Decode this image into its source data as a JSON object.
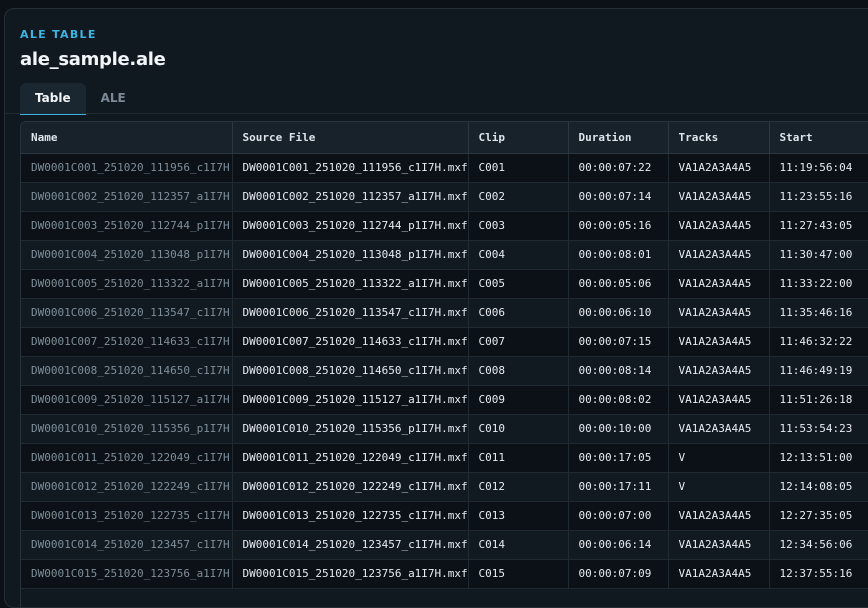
{
  "header": {
    "kicker": "ALE TABLE",
    "file_name": "ale_sample.ale"
  },
  "tabs": [
    {
      "label": "Table",
      "active": true
    },
    {
      "label": "ALE",
      "active": false
    }
  ],
  "table": {
    "columns": [
      "Name",
      "Source File",
      "Clip",
      "Duration",
      "Tracks",
      "Start"
    ],
    "rows": [
      [
        "DW0001C001_251020_111956_c1I7H",
        "DW0001C001_251020_111956_c1I7H.mxf",
        "C001",
        "00:00:07:22",
        "VA1A2A3A4A5",
        "11:19:56:04"
      ],
      [
        "DW0001C002_251020_112357_a1I7H",
        "DW0001C002_251020_112357_a1I7H.mxf",
        "C002",
        "00:00:07:14",
        "VA1A2A3A4A5",
        "11:23:55:16"
      ],
      [
        "DW0001C003_251020_112744_p1I7H",
        "DW0001C003_251020_112744_p1I7H.mxf",
        "C003",
        "00:00:05:16",
        "VA1A2A3A4A5",
        "11:27:43:05"
      ],
      [
        "DW0001C004_251020_113048_p1I7H",
        "DW0001C004_251020_113048_p1I7H.mxf",
        "C004",
        "00:00:08:01",
        "VA1A2A3A4A5",
        "11:30:47:00"
      ],
      [
        "DW0001C005_251020_113322_a1I7H",
        "DW0001C005_251020_113322_a1I7H.mxf",
        "C005",
        "00:00:05:06",
        "VA1A2A3A4A5",
        "11:33:22:00"
      ],
      [
        "DW0001C006_251020_113547_c1I7H",
        "DW0001C006_251020_113547_c1I7H.mxf",
        "C006",
        "00:00:06:10",
        "VA1A2A3A4A5",
        "11:35:46:16"
      ],
      [
        "DW0001C007_251020_114633_c1I7H",
        "DW0001C007_251020_114633_c1I7H.mxf",
        "C007",
        "00:00:07:15",
        "VA1A2A3A4A5",
        "11:46:32:22"
      ],
      [
        "DW0001C008_251020_114650_c1I7H",
        "DW0001C008_251020_114650_c1I7H.mxf",
        "C008",
        "00:00:08:14",
        "VA1A2A3A4A5",
        "11:46:49:19"
      ],
      [
        "DW0001C009_251020_115127_a1I7H",
        "DW0001C009_251020_115127_a1I7H.mxf",
        "C009",
        "00:00:08:02",
        "VA1A2A3A4A5",
        "11:51:26:18"
      ],
      [
        "DW0001C010_251020_115356_p1I7H",
        "DW0001C010_251020_115356_p1I7H.mxf",
        "C010",
        "00:00:10:00",
        "VA1A2A3A4A5",
        "11:53:54:23"
      ],
      [
        "DW0001C011_251020_122049_c1I7H",
        "DW0001C011_251020_122049_c1I7H.mxf",
        "C011",
        "00:00:17:05",
        "V",
        "12:13:51:00"
      ],
      [
        "DW0001C012_251020_122249_c1I7H",
        "DW0001C012_251020_122249_c1I7H.mxf",
        "C012",
        "00:00:17:11",
        "V",
        "12:14:08:05"
      ],
      [
        "DW0001C013_251020_122735_c1I7H",
        "DW0001C013_251020_122735_c1I7H.mxf",
        "C013",
        "00:00:07:00",
        "VA1A2A3A4A5",
        "12:27:35:05"
      ],
      [
        "DW0001C014_251020_123457_c1I7H",
        "DW0001C014_251020_123457_c1I7H.mxf",
        "C014",
        "00:00:06:14",
        "VA1A2A3A4A5",
        "12:34:56:06"
      ],
      [
        "DW0001C015_251020_123756_a1I7H",
        "DW0001C015_251020_123756_a1I7H.mxf",
        "C015",
        "00:00:07:09",
        "VA1A2A3A4A5",
        "12:37:55:16"
      ]
    ]
  }
}
